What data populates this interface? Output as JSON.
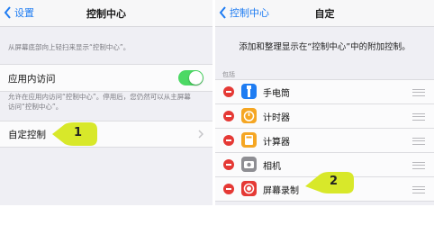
{
  "left": {
    "back_label": "设置",
    "title": "控制中心",
    "description": "从屏幕底部向上轻扫来显示“控制中心”。",
    "access_row": {
      "label": "应用内访问",
      "toggle_on": true
    },
    "access_note_line1": "允许在应用内访问“控制中心”。停用后，您仍然可以从主屏幕",
    "access_note_line2": "访问“控制中心”。",
    "customize_row": {
      "label": "自定控制"
    },
    "callout_number": "1"
  },
  "right": {
    "back_label": "控制中心",
    "title": "自定",
    "header_text": "添加和整理显示在“控制中心”中的附加控制。",
    "section_label": "包括",
    "items": [
      {
        "label": "手电筒",
        "icon": "flashlight-icon",
        "icon_color": "#1e7cf2"
      },
      {
        "label": "计时器",
        "icon": "timer-icon",
        "icon_color": "#f5a623"
      },
      {
        "label": "计算器",
        "icon": "calculator-icon",
        "icon_color": "#f5a623"
      },
      {
        "label": "相机",
        "icon": "camera-icon",
        "icon_color": "#8e8e93"
      },
      {
        "label": "屏幕录制",
        "icon": "screen-record-icon",
        "icon_color": "#e53935"
      }
    ],
    "callout_number": "2"
  },
  "colors": {
    "ios_blue": "#1e7cf2",
    "switch_green": "#4cd964",
    "delete_red": "#e53935",
    "callout_yellow": "#d8e82a"
  }
}
